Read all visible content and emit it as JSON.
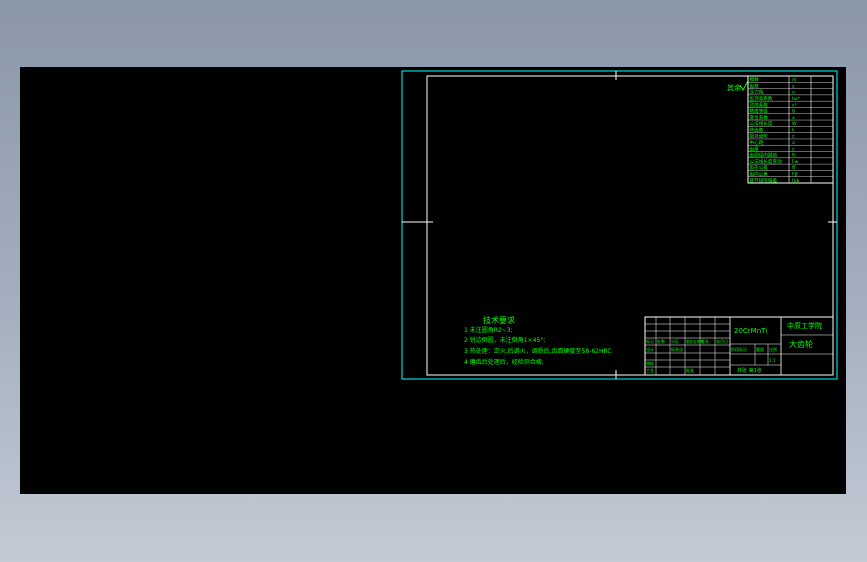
{
  "colors": {
    "background_top": "#8a97a8",
    "background_bottom": "#c3cad5",
    "viewport": "#000000",
    "sheet_border": "#00ffff",
    "frame": "#ffffff",
    "annotation": "#00ff00"
  },
  "drawing": {
    "surface_mark": "其余",
    "tech_requirements": {
      "title": "技术要求",
      "items": [
        "1 未注圆角R2~3;",
        "2 锐边倒圆，未注倒角1×45°;",
        "3 热处理：正火,后调火，调质后,齿面硬度至58-62HRC",
        "4 磨齿后处理后，经检测合格;"
      ]
    },
    "title_block": {
      "material": "20CrMnTi",
      "company": "中原工学院",
      "part_name": "大齿轮",
      "sheet_info": "共张 第1张",
      "cells": [
        "标记",
        "处数",
        "分区",
        "更改文件号",
        "签名",
        "年月日",
        "设计",
        "标准化",
        "审核",
        "工艺",
        "批准",
        "阶段标记",
        "重量",
        "比例",
        "1:1"
      ]
    },
    "param_table": [
      {
        "label": "模数",
        "value": "m"
      },
      {
        "label": "齿数",
        "value": "z"
      },
      {
        "label": "压力角",
        "value": "α"
      },
      {
        "label": "齿顶高系数",
        "value": "ha*"
      },
      {
        "label": "顶隙系数",
        "value": "c*"
      },
      {
        "label": "精度等级",
        "value": "8"
      },
      {
        "label": "变位系数",
        "value": "x"
      },
      {
        "label": "公法线长度",
        "value": "W"
      },
      {
        "label": "跨齿数",
        "value": "k"
      },
      {
        "label": "配对齿轮",
        "value": "z"
      },
      {
        "label": "中心距",
        "value": "a"
      },
      {
        "label": "齿厚",
        "value": "s"
      },
      {
        "label": "齿圈径向跳动",
        "value": "Fr"
      },
      {
        "label": "公法线长度变动",
        "value": "Fw"
      },
      {
        "label": "齿形公差",
        "value": "ff"
      },
      {
        "label": "齿向公差",
        "value": "Fβ"
      },
      {
        "label": "基节极限偏差",
        "value": "fpb"
      }
    ]
  }
}
